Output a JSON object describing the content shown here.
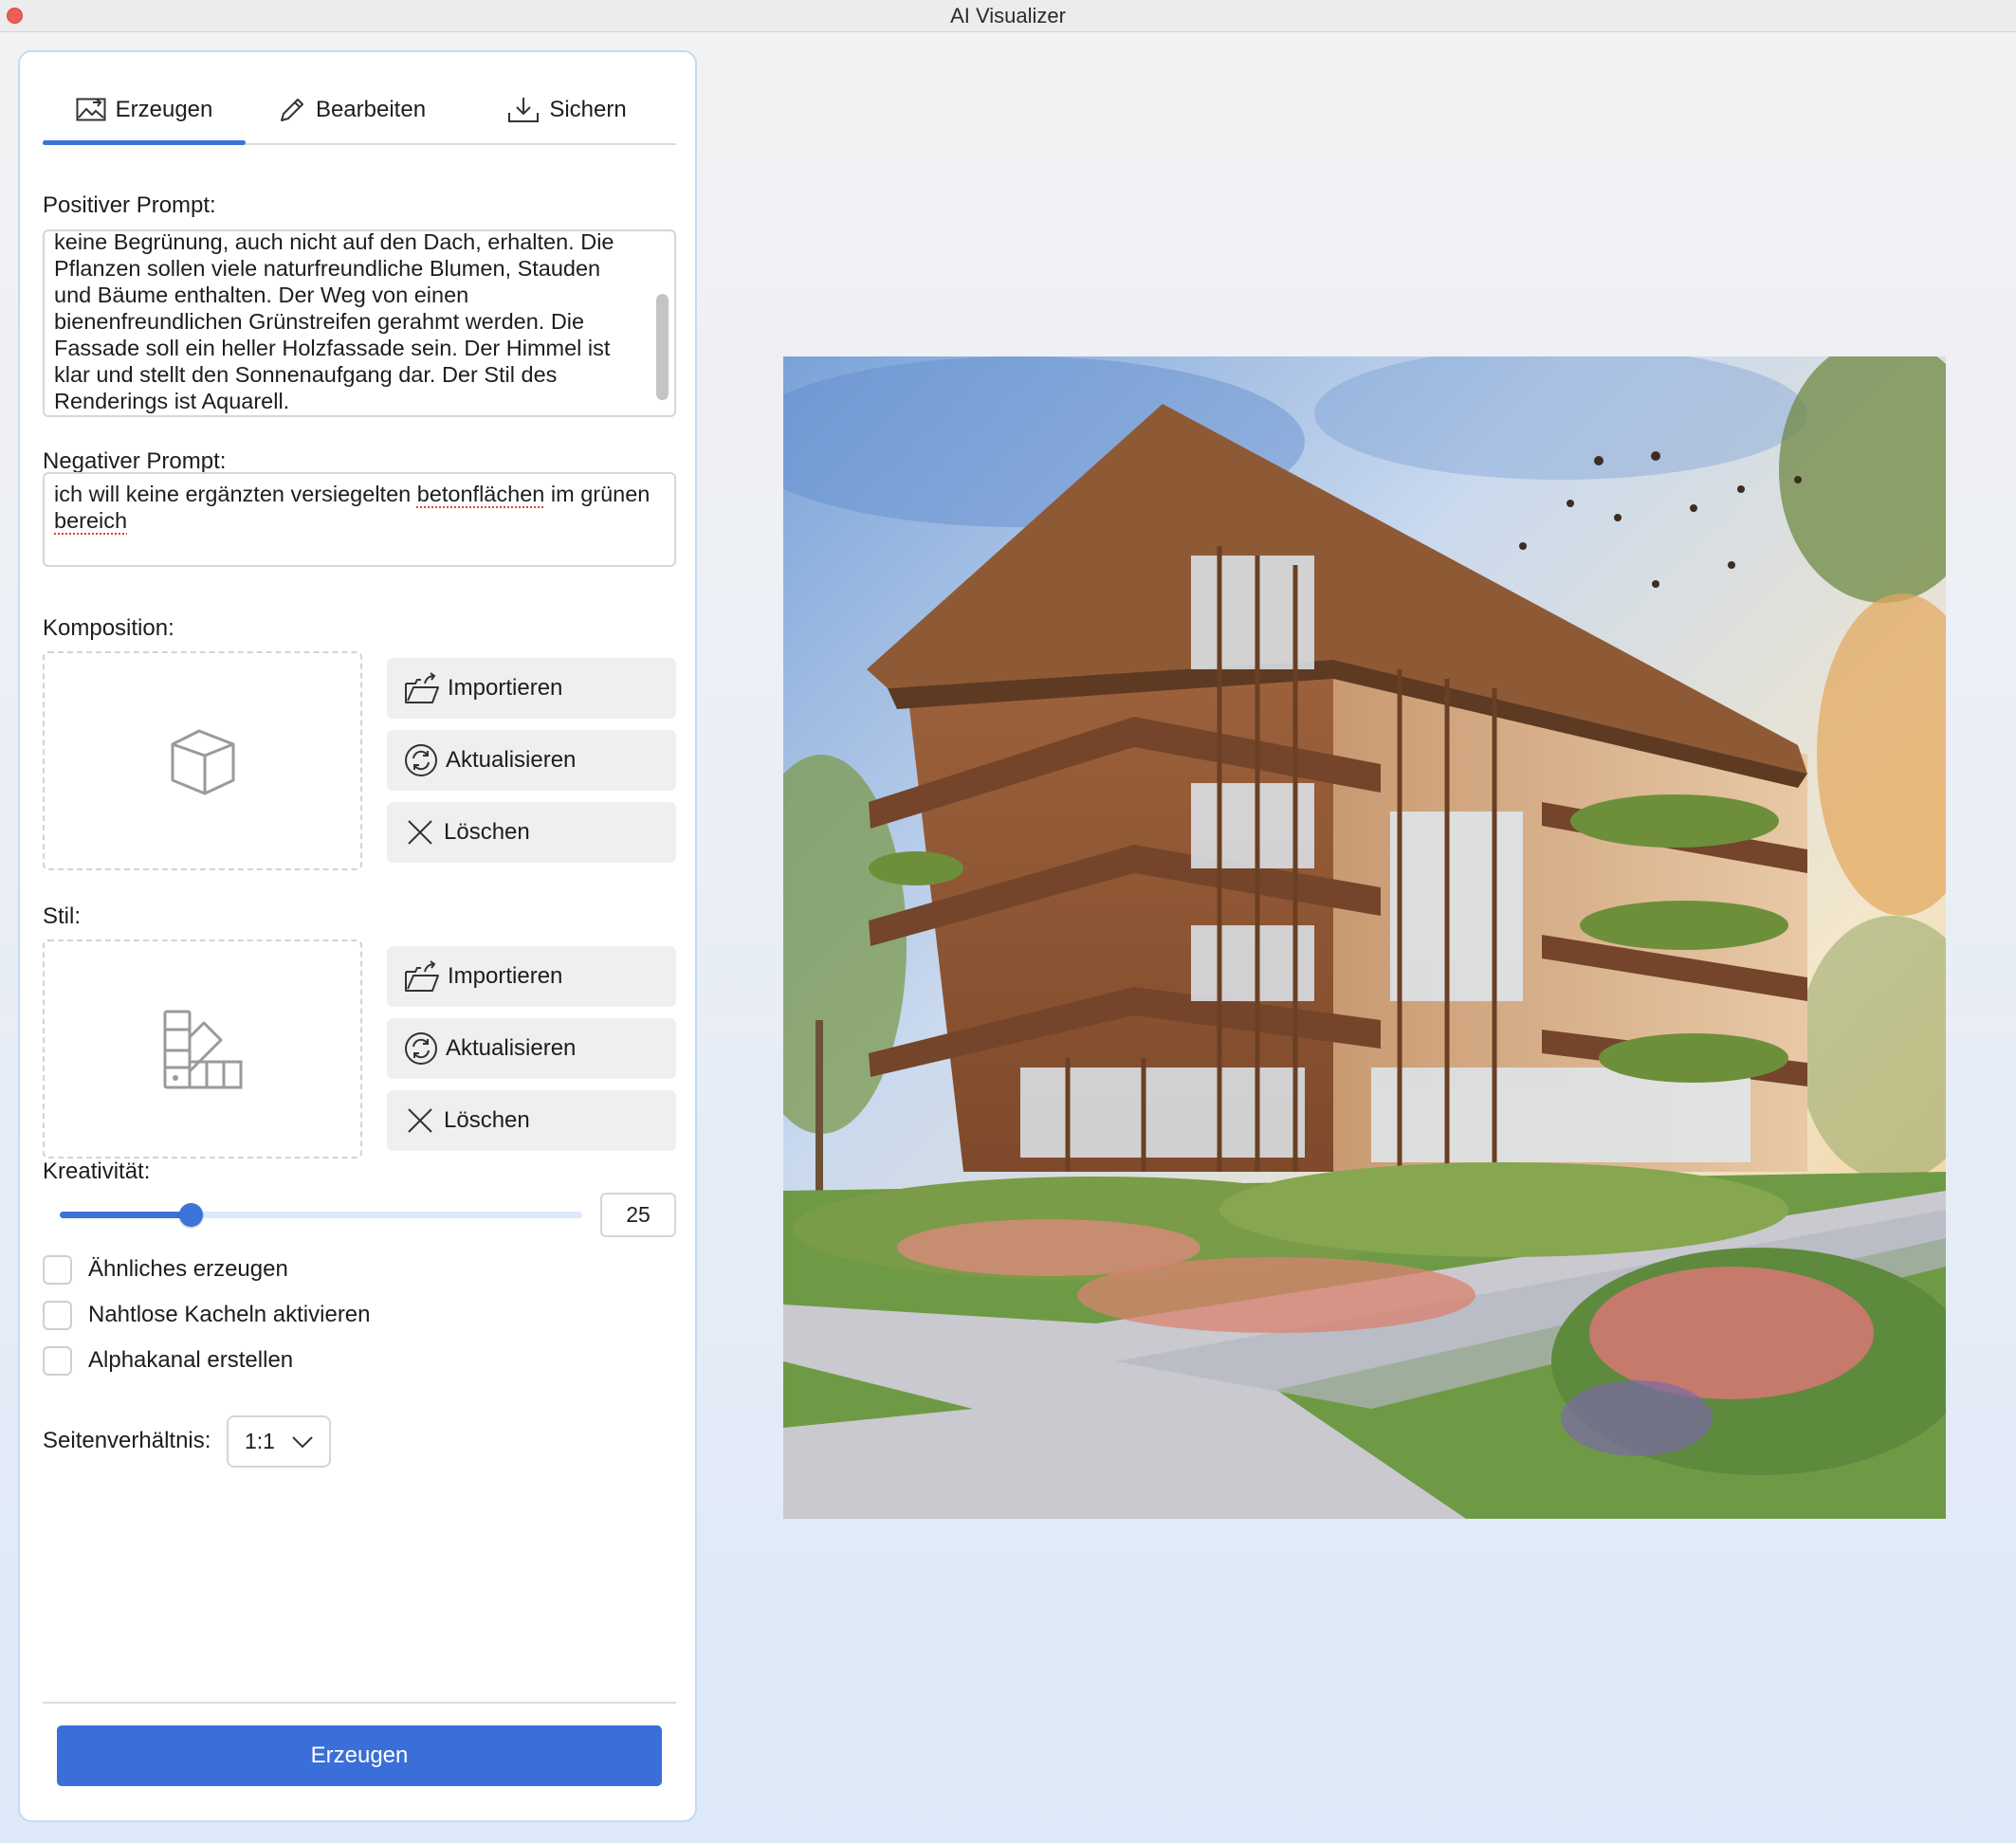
{
  "window": {
    "title": "AI Visualizer"
  },
  "tabs": [
    {
      "label": "Erzeugen",
      "icon": "image-edit-icon",
      "active": true
    },
    {
      "label": "Bearbeiten",
      "icon": "pencil-icon",
      "active": false
    },
    {
      "label": "Sichern",
      "icon": "download-icon",
      "active": false
    }
  ],
  "positive_prompt": {
    "label": "Positiver Prompt:",
    "lines": [
      "keine Begrünung, auch nicht auf den Dach, erhalten. Die",
      "Pflanzen sollen viele naturfreundliche Blumen, Stauden",
      "und Bäume enthalten. Der Weg von einen",
      "bienenfreundlichen Grünstreifen gerahmt werden. Die",
      "Fassade soll ein heller Holzfassade sein. Der Himmel ist",
      "klar und stellt den Sonnenaufgang dar. Der Stil des",
      "Renderings ist Aquarell."
    ]
  },
  "negative_prompt": {
    "label": "Negativer Prompt:",
    "line1_before": "ich will keine ergänzten versiegelten ",
    "line1_misspelled": "betonflächen",
    "line1_after": " im grünen",
    "line2_misspelled": "bereich"
  },
  "komposition": {
    "label": "Komposition:",
    "placeholder_icon": "cube-icon",
    "buttons": {
      "import": "Importieren",
      "refresh": "Aktualisieren",
      "delete": "Löschen"
    }
  },
  "stil": {
    "label": "Stil:",
    "placeholder_icon": "color-swatch-icon",
    "buttons": {
      "import": "Importieren",
      "refresh": "Aktualisieren",
      "delete": "Löschen"
    }
  },
  "kreativitaet": {
    "label": "Kreativität:",
    "value": 25,
    "min": 0,
    "max": 100,
    "value_text": "25"
  },
  "options": [
    {
      "label": "Ähnliches erzeugen",
      "checked": false
    },
    {
      "label": "Nahtlose Kacheln aktivieren",
      "checked": false
    },
    {
      "label": "Alphakanal erstellen",
      "checked": false
    }
  ],
  "aspect_ratio": {
    "label": "Seitenverhältnis:",
    "value": "1:1"
  },
  "generate_button": "Erzeugen",
  "colors": {
    "accent": "#3a6ed8",
    "panel_border": "#c3dbf4",
    "button_bg": "#efefef"
  }
}
